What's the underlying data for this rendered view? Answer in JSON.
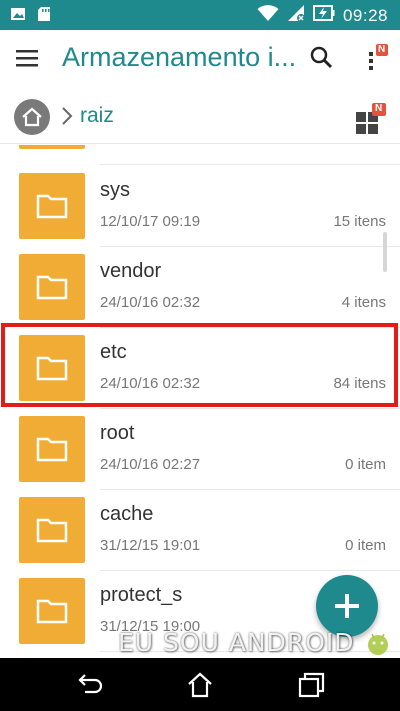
{
  "status_bar": {
    "time": "09:28",
    "background_color": "#1f8a8e",
    "left_icons": [
      "image-icon",
      "sd-card-icon"
    ],
    "right_icons": [
      "wifi-icon",
      "signal-no-data-icon",
      "battery-charging-icon"
    ]
  },
  "app_bar": {
    "title": "Armazenamento i...",
    "menu_icon": "hamburger-menu-icon",
    "search_icon": "search-icon",
    "more_icon": "more-vert-icon",
    "more_badge": "N"
  },
  "breadcrumb": {
    "home_icon": "home-icon",
    "root_label": "raiz",
    "view_toggle_icon": "grid-view-icon",
    "view_toggle_badge": "N"
  },
  "files": [
    {
      "name": "sys",
      "date": "12/10/17 09:19",
      "count": "15 itens",
      "highlighted": false
    },
    {
      "name": "vendor",
      "date": "24/10/16 02:32",
      "count": "4 itens",
      "highlighted": false
    },
    {
      "name": "etc",
      "date": "24/10/16 02:32",
      "count": "84 itens",
      "highlighted": true
    },
    {
      "name": "root",
      "date": "24/10/16 02:27",
      "count": "0 item",
      "highlighted": false
    },
    {
      "name": "cache",
      "date": "31/12/15 19:01",
      "count": "0 item",
      "highlighted": false
    },
    {
      "name": "protect_s",
      "date": "31/12/15 19:00",
      "count": "",
      "highlighted": false
    }
  ],
  "fab": {
    "icon": "plus-icon"
  },
  "watermark": {
    "text": "EU SOU ANDROID"
  },
  "nav_bar": {
    "icons": [
      "back-icon",
      "home-icon",
      "recents-icon"
    ]
  },
  "colors": {
    "accent": "#1f8a8e",
    "folder": "#f0ac35",
    "highlight": "#e21b1b",
    "badge": "#e5533c"
  }
}
